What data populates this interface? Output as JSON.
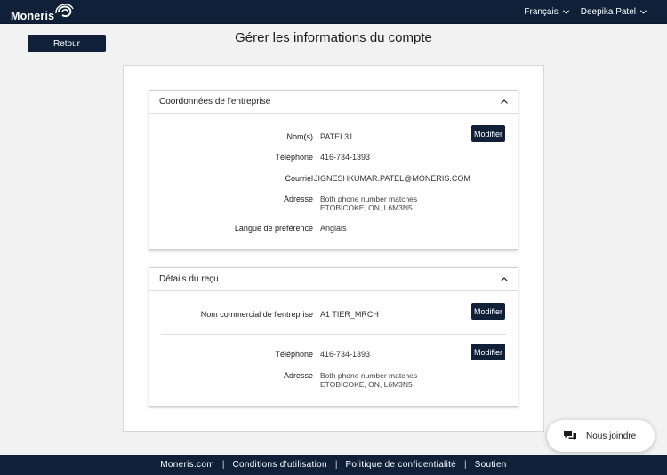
{
  "header": {
    "logo_text": "Moneris",
    "language": "Français",
    "user": "Deepika Patel"
  },
  "back_label": "Retour",
  "page_title": "Gérer les informations du compte",
  "company_section": {
    "title": "Coordonnées de l'entreprise",
    "modify_label": "Modifier",
    "fields": {
      "name_label": "Nom(s)",
      "name_value": "PATEL31",
      "phone_label": "Téléphone",
      "phone_value": "416-734-1393",
      "email_label": "Courriel",
      "email_value": "JIGNESHKUMAR.PATEL@MONERIS.COM",
      "address_label": "Adresse",
      "address_line1": "Both phone number matches",
      "address_line2": "ETOBICOKE, ON, L6M3N5",
      "language_label": "Langue de préférence",
      "language_value": "Anglais"
    }
  },
  "receipt_section": {
    "title": "Détails du reçu",
    "modify_label": "Modifier",
    "fields": {
      "trade_name_label": "Nom commercial de l'entreprise",
      "trade_name_value": "A1 TIER_MRCH",
      "phone_label": "Téléphone",
      "phone_value": "416-734-1393",
      "address_label": "Adresse",
      "address_line1": "Both phone number matches",
      "address_line2": "ETOBICOKE, ON, L6M3N5"
    }
  },
  "chat_label": "Nous joindre",
  "footer": {
    "links": [
      "Moneris.com",
      "Conditions d'utilisation",
      "Politique de confidentialité",
      "Soutien"
    ],
    "separator": "|"
  },
  "colors": {
    "navy": "#0f2038",
    "background": "#f2f2f2"
  },
  "icons": [
    "logo-swirl-icon",
    "chevron-down-icon",
    "chevron-up-icon",
    "chat-bubbles-icon"
  ]
}
